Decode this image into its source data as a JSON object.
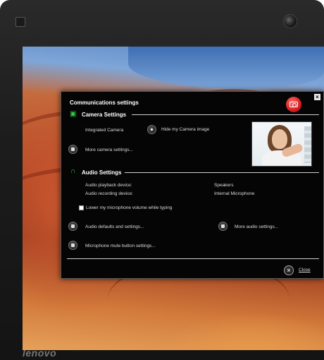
{
  "dialog": {
    "title": "Communications settings",
    "close_x": "×"
  },
  "camera": {
    "header": "Camera Settings",
    "device": "Integrated Camera",
    "hide_image": "Hide my Camera image",
    "more_settings": "More camera settings..."
  },
  "audio": {
    "header": "Audio Settings",
    "playback_label": "Audio playback device:",
    "playback_value": "Speakers",
    "recording_label": "Audio recording device:",
    "recording_value": "Internal Microphone",
    "lower_volume": "Lower my microphone volume while typing",
    "defaults": "Audio defaults and settings...",
    "more_settings": "More audio settings...",
    "mute_settings": "Microphone mute button settings..."
  },
  "footer": {
    "close": "Close"
  },
  "laptop": {
    "brand": "lenovo"
  },
  "icons": {
    "camera_section": "camera-icon",
    "audio_section": "headset-icon",
    "app_badge": "camera-icon",
    "close": "close-icon"
  },
  "colors": {
    "accent_green": "#2ecc40",
    "app_badge_red": "#d81d1d"
  }
}
